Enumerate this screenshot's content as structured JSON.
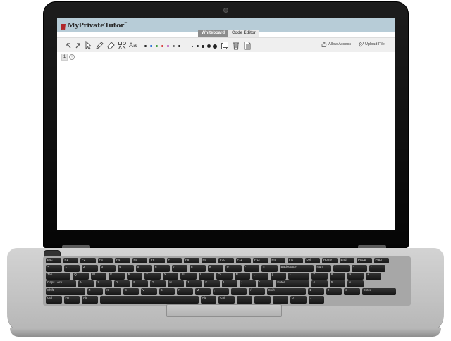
{
  "app": {
    "brand": "MyPrivateTutor",
    "brand_mark": "™"
  },
  "tabs": [
    {
      "label": "Whiteboard",
      "active": true
    },
    {
      "label": "Code Editor",
      "active": false
    }
  ],
  "toolbar": {
    "tools": [
      {
        "name": "undo-icon"
      },
      {
        "name": "redo-icon"
      },
      {
        "name": "select-icon"
      },
      {
        "name": "pencil-icon"
      },
      {
        "name": "eraser-icon"
      },
      {
        "name": "shapes-icon"
      },
      {
        "name": "text-icon",
        "label": "Aa"
      }
    ],
    "colors": [
      "#222222",
      "#2e6fd6",
      "#3a9a3a",
      "#d63a3a",
      "#b23ab2",
      "#6b6b6b",
      "#222222"
    ],
    "stroke_sizes": [
      "xs",
      "s",
      "m",
      "l",
      "xl"
    ],
    "allow_access_label": "Allow Access",
    "upload_file_label": "Upload File"
  },
  "pages": {
    "current": "1",
    "add_label": "+"
  },
  "keyboard": {
    "row0": [
      "Esc",
      "F1",
      "F2",
      "F3",
      "F4",
      "F5",
      "F6",
      "F7",
      "F8",
      "F9",
      "F10",
      "F11",
      "F12",
      "Prt",
      "Ins",
      "Del",
      "Home",
      "End",
      "PgUp",
      "PgDn"
    ],
    "row1": [
      "~",
      "1",
      "2",
      "3",
      "4",
      "5",
      "6",
      "7",
      "8",
      "9",
      "0",
      "-",
      "=",
      "Backspace",
      "Num",
      "/",
      "*",
      "-"
    ],
    "row2": [
      "Tab",
      "Q",
      "W",
      "E",
      "R",
      "T",
      "Y",
      "U",
      "I",
      "O",
      "P",
      "[",
      "]",
      "\\",
      "7",
      "8",
      "9",
      "+"
    ],
    "row3": [
      "Caps Lock",
      "A",
      "S",
      "D",
      "F",
      "G",
      "H",
      "J",
      "K",
      "L",
      ";",
      "'",
      "Enter",
      "4",
      "5",
      "6"
    ],
    "row4": [
      "Shift",
      "Z",
      "X",
      "C",
      "V",
      "B",
      "N",
      "M",
      ",",
      ".",
      "/",
      "Shift",
      "1",
      "2",
      "3",
      "Enter"
    ],
    "row5": [
      "Ctrl",
      "Fn",
      "Alt",
      "",
      "Alt",
      "Ctrl",
      "",
      "",
      "",
      "0",
      "."
    ]
  }
}
